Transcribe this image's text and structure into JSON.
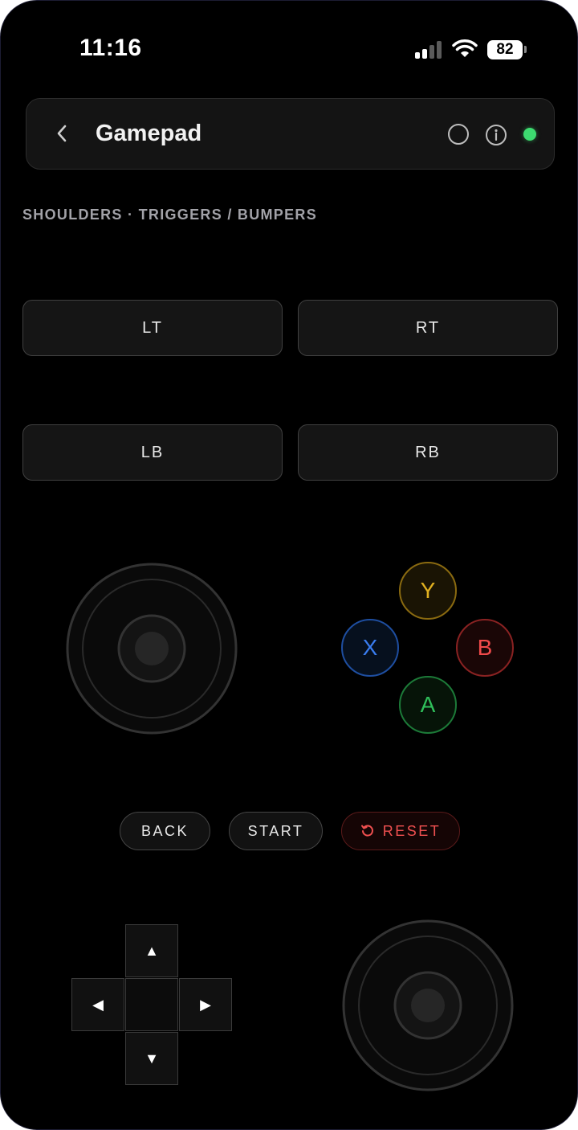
{
  "status": {
    "time": "11:16",
    "battery": "82"
  },
  "header": {
    "title": "Gamepad"
  },
  "section": {
    "label": "SHOULDERS · TRIGGERS / BUMPERS"
  },
  "shoulders": {
    "lt": "LT",
    "rt": "RT",
    "lb": "LB",
    "rb": "RB"
  },
  "face_buttons": {
    "y": {
      "label": "Y",
      "color": "#e0b020"
    },
    "x": {
      "label": "X",
      "color": "#3a7df0"
    },
    "b": {
      "label": "B",
      "color": "#f04a4a"
    },
    "a": {
      "label": "A",
      "color": "#2fbf5a"
    }
  },
  "system_buttons": {
    "back": "BACK",
    "start": "START",
    "reset": "RESET"
  },
  "dpad": {
    "up": "▲",
    "down": "▼",
    "left": "◀",
    "right": "▶"
  },
  "colors": {
    "online": "#3ddc70",
    "reset": "#f05050"
  }
}
